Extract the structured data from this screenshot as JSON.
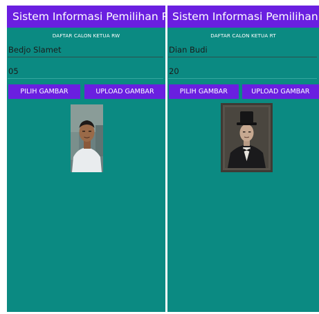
{
  "left": {
    "app_title": "Sistem Informasi Pemilihan R...",
    "subtitle": "DAFTAR CALON KETUA RW",
    "name_value": "Bedjo Slamet",
    "number_value": "05",
    "pick_button": "PILIH GAMBAR",
    "upload_button": "UPLOAD GAMBAR",
    "photo_icon": "candidate-photo"
  },
  "right": {
    "app_title": "Sistem Informasi Pemilihan R...",
    "subtitle": "DAFTAR CALON KETUA RT",
    "name_value": "Dian Budi",
    "number_value": "20",
    "pick_button": "PILIH GAMBAR",
    "upload_button": "UPLOAD GAMBAR",
    "photo_icon": "candidate-photo"
  },
  "colors": {
    "app_bar": "#6a1fe0",
    "background": "#0b8a82",
    "button": "#6a1fe0"
  }
}
